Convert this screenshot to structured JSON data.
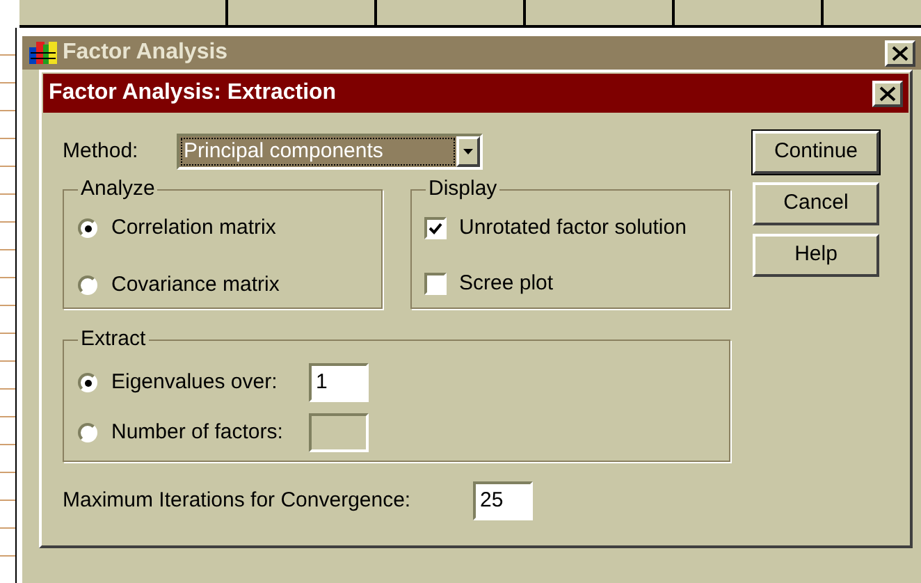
{
  "background_window": {
    "title": "Factor Analysis"
  },
  "dialog": {
    "title": "Factor Analysis: Extraction",
    "method": {
      "label": "Method:",
      "value": "Principal components"
    },
    "analyze": {
      "title": "Analyze",
      "options": [
        {
          "label": "Correlation matrix",
          "selected": true
        },
        {
          "label": "Covariance matrix",
          "selected": false
        }
      ]
    },
    "display": {
      "title": "Display",
      "options": [
        {
          "label": "Unrotated factor solution",
          "checked": true
        },
        {
          "label": "Scree plot",
          "checked": false
        }
      ]
    },
    "extract": {
      "title": "Extract",
      "options": [
        {
          "label": "Eigenvalues over:",
          "selected": true,
          "value": "1",
          "disabled": false
        },
        {
          "label": "Number of factors:",
          "selected": false,
          "disabled": true
        }
      ]
    },
    "max_iterations": {
      "label": "Maximum Iterations for Convergence:",
      "value": "25"
    },
    "buttons": [
      {
        "label": "Continue",
        "default": true
      },
      {
        "label": "Cancel",
        "default": false
      },
      {
        "label": "Help",
        "default": false
      }
    ]
  }
}
